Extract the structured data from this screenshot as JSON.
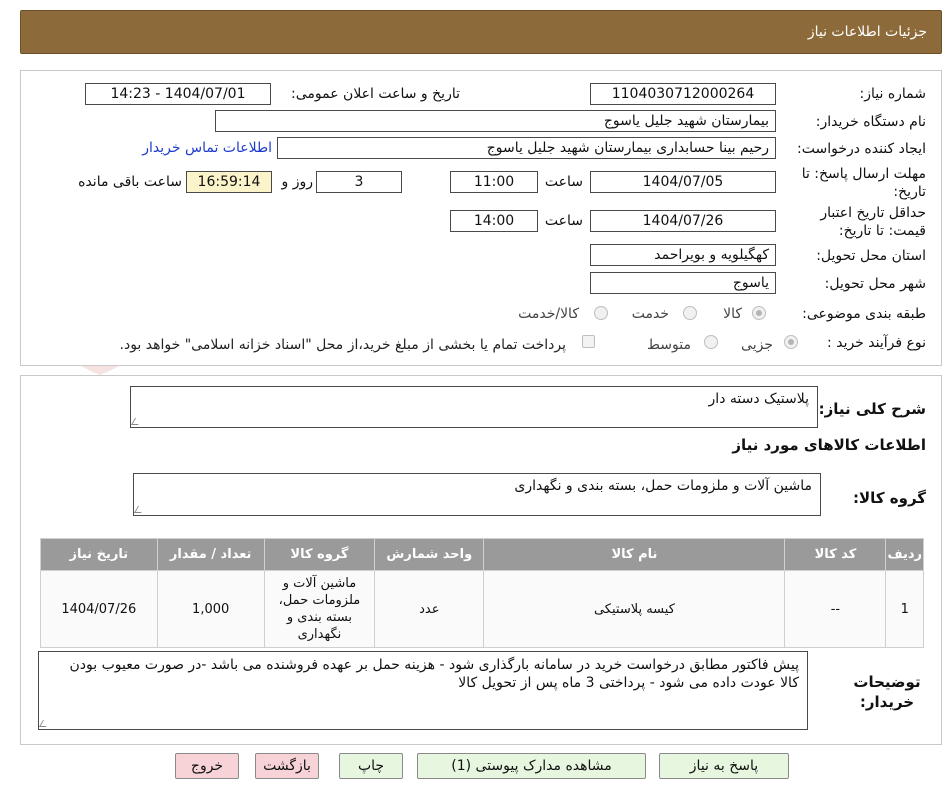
{
  "header": {
    "title": "جزئیات اطلاعات نیاز"
  },
  "need_number": {
    "label": "شماره نیاز:",
    "value": "1104030712000264"
  },
  "announce": {
    "label": "تاریخ و ساعت اعلان عمومی:",
    "value": "1404/07/01 - 14:23"
  },
  "buyer_org": {
    "label": "نام دستگاه خریدار:",
    "value": "بیمارستان شهید جلیل یاسوج"
  },
  "requester": {
    "label": "ایجاد کننده درخواست:",
    "value": "رحیم بینا حسابداری بیمارستان شهید جلیل یاسوج",
    "contact_link": "اطلاعات تماس خریدار"
  },
  "reply_deadline": {
    "label": "مهلت ارسال پاسخ: تا تاریخ:",
    "date": "1404/07/05",
    "time_label": "ساعت",
    "time": "11:00",
    "days": "3",
    "days_label": "روز و",
    "remaining": "16:59:14",
    "remaining_label": "ساعت باقی مانده"
  },
  "price_validity": {
    "label": "حداقل تاریخ اعتبار قیمت: تا تاریخ:",
    "date": "1404/07/26",
    "time_label": "ساعت",
    "time": "14:00"
  },
  "province": {
    "label": "استان محل تحویل:",
    "value": "کهگیلویه و بویراحمد"
  },
  "city": {
    "label": "شهر محل تحویل:",
    "value": "یاسوج"
  },
  "category": {
    "label": "طبقه بندی موضوعی:",
    "options": [
      "کالا",
      "خدمت",
      "کالا/خدمت"
    ],
    "selected": "کالا"
  },
  "process": {
    "label": "نوع فرآیند خرید :",
    "options": [
      "جزیی",
      "متوسط"
    ],
    "selected": "جزیی",
    "checkbox_text": "پرداخت تمام یا بخشی از مبلغ خرید،از محل \"اسناد خزانه اسلامی\" خواهد بود."
  },
  "summary": {
    "label": "شرح کلی نیاز:",
    "value": "پلاستیک دسته دار"
  },
  "goods_info": {
    "title": "اطلاعات کالاهای مورد نیاز"
  },
  "goods_group": {
    "label": "گروه کالا:",
    "value": "ماشین آلات و ملزومات حمل، بسته بندی و نگهداری"
  },
  "table": {
    "headers": [
      "ردیف",
      "کد کالا",
      "نام کالا",
      "واحد شمارش",
      "گروه کالا",
      "تعداد / مقدار",
      "تاریخ نیاز"
    ],
    "rows": [
      [
        "1",
        "--",
        "کیسه پلاستیکی",
        "عدد",
        "ماشین آلات و ملزومات حمل، بسته بندی و نگهداری",
        "1,000",
        "1404/07/26"
      ]
    ]
  },
  "buyer_notes": {
    "label": "توضیحات خریدار:",
    "line1": "پیش فاکتور مطابق درخواست خرید در سامانه بارگذاری شود - هزینه حمل بر عهده فروشنده می باشد -در صورت معیوب بودن",
    "line2": "کالا عودت داده می شود - پرداختی 3 ماه پس از تحویل کالا"
  },
  "buttons": {
    "reply": "پاسخ به نیاز",
    "docs": "مشاهده مدارک پیوستی (1)",
    "print": "چاپ",
    "back": "بازگشت",
    "exit": "خروج"
  },
  "watermark": "AriaTender.net",
  "colors": {
    "header_bg": "#8d6a3a",
    "table_header": "#9a9a9a",
    "link": "#1d3ad1",
    "btn_green": "#e6f6df",
    "btn_pink": "#f7d3d7"
  }
}
